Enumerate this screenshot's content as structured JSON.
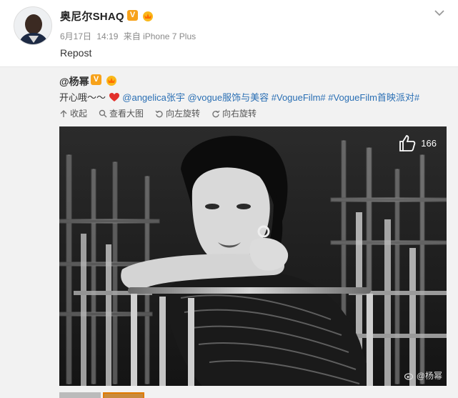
{
  "post": {
    "author": "奥尼尔SHAQ",
    "verified_badge": "V",
    "date": "6月17日",
    "time": "14:19",
    "source": "来自 iPhone 7 Plus",
    "text": "Repost"
  },
  "original": {
    "author": "@杨幂",
    "verified_badge": "V",
    "text_prefix": "开心哦～～",
    "mention_1": "@angelica张宇",
    "mention_2": "@vogue服饰与美容",
    "tag_1": "#VogueFilm#",
    "tag_2": "#VogueFilm首映派对#"
  },
  "actions": {
    "collapse": "收起",
    "view_large": "查看大图",
    "rotate_left": "向左旋转",
    "rotate_right": "向右旋转"
  },
  "photo": {
    "like_count": "166",
    "watermark": "@杨幂"
  },
  "colors": {
    "link": "#2a6fb4",
    "badge": "#f7a21b",
    "card_bg": "#f2f2f2"
  },
  "icons": [
    "chevron-down-icon",
    "collapse-arrow-icon",
    "zoom-icon",
    "rotate-left-icon",
    "rotate-right-icon",
    "thumbs-up-icon",
    "heart-icon",
    "vip-crown-icon",
    "weibo-logo-icon"
  ]
}
